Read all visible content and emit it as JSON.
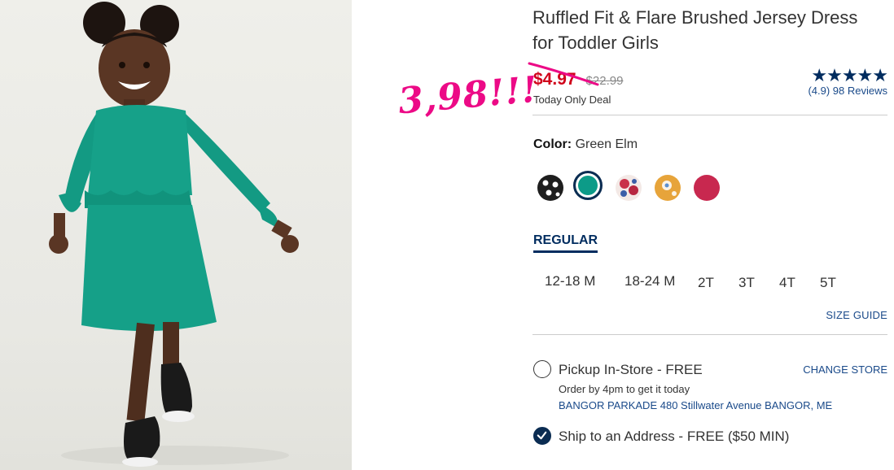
{
  "product": {
    "title": "Ruffled Fit & Flare Brushed Jersey Dress for Toddler Girls",
    "sale_price": "$4.97",
    "regular_price": "$22.99",
    "deal_label": "Today Only Deal",
    "annotation": "3,98!!!",
    "rating_stars": "★★★★★",
    "rating_text": "(4.9) 98 Reviews"
  },
  "color": {
    "label": "Color:",
    "value": "Green Elm",
    "swatches": [
      {
        "name": "black-dot",
        "color": "#1e1e1e"
      },
      {
        "name": "green-elm",
        "color": "#0c9b88",
        "selected": true
      },
      {
        "name": "floral-red",
        "color": "#c9324a"
      },
      {
        "name": "floral-yellow",
        "color": "#e7a43a"
      },
      {
        "name": "raspberry",
        "color": "#c8284f"
      }
    ]
  },
  "fit": {
    "tab_label": "REGULAR"
  },
  "sizes": [
    "12-18 M",
    "18-24 M",
    "2T",
    "3T",
    "4T",
    "5T"
  ],
  "size_guide": "SIZE GUIDE",
  "fulfillment": {
    "pickup_label": "Pickup In-Store - FREE",
    "pickup_sub": "Order by 4pm to get it today",
    "store_address": "BANGOR PARKADE 480 Stillwater Avenue  BANGOR, ME",
    "change_store": "CHANGE STORE",
    "ship_label": "Ship to an Address - FREE ($50 MIN)"
  },
  "colors": {
    "brand_navy": "#002c5f",
    "sale_red": "#d0021b",
    "annotation_pink": "#ec0a86",
    "dress_green": "#0c9b88"
  }
}
